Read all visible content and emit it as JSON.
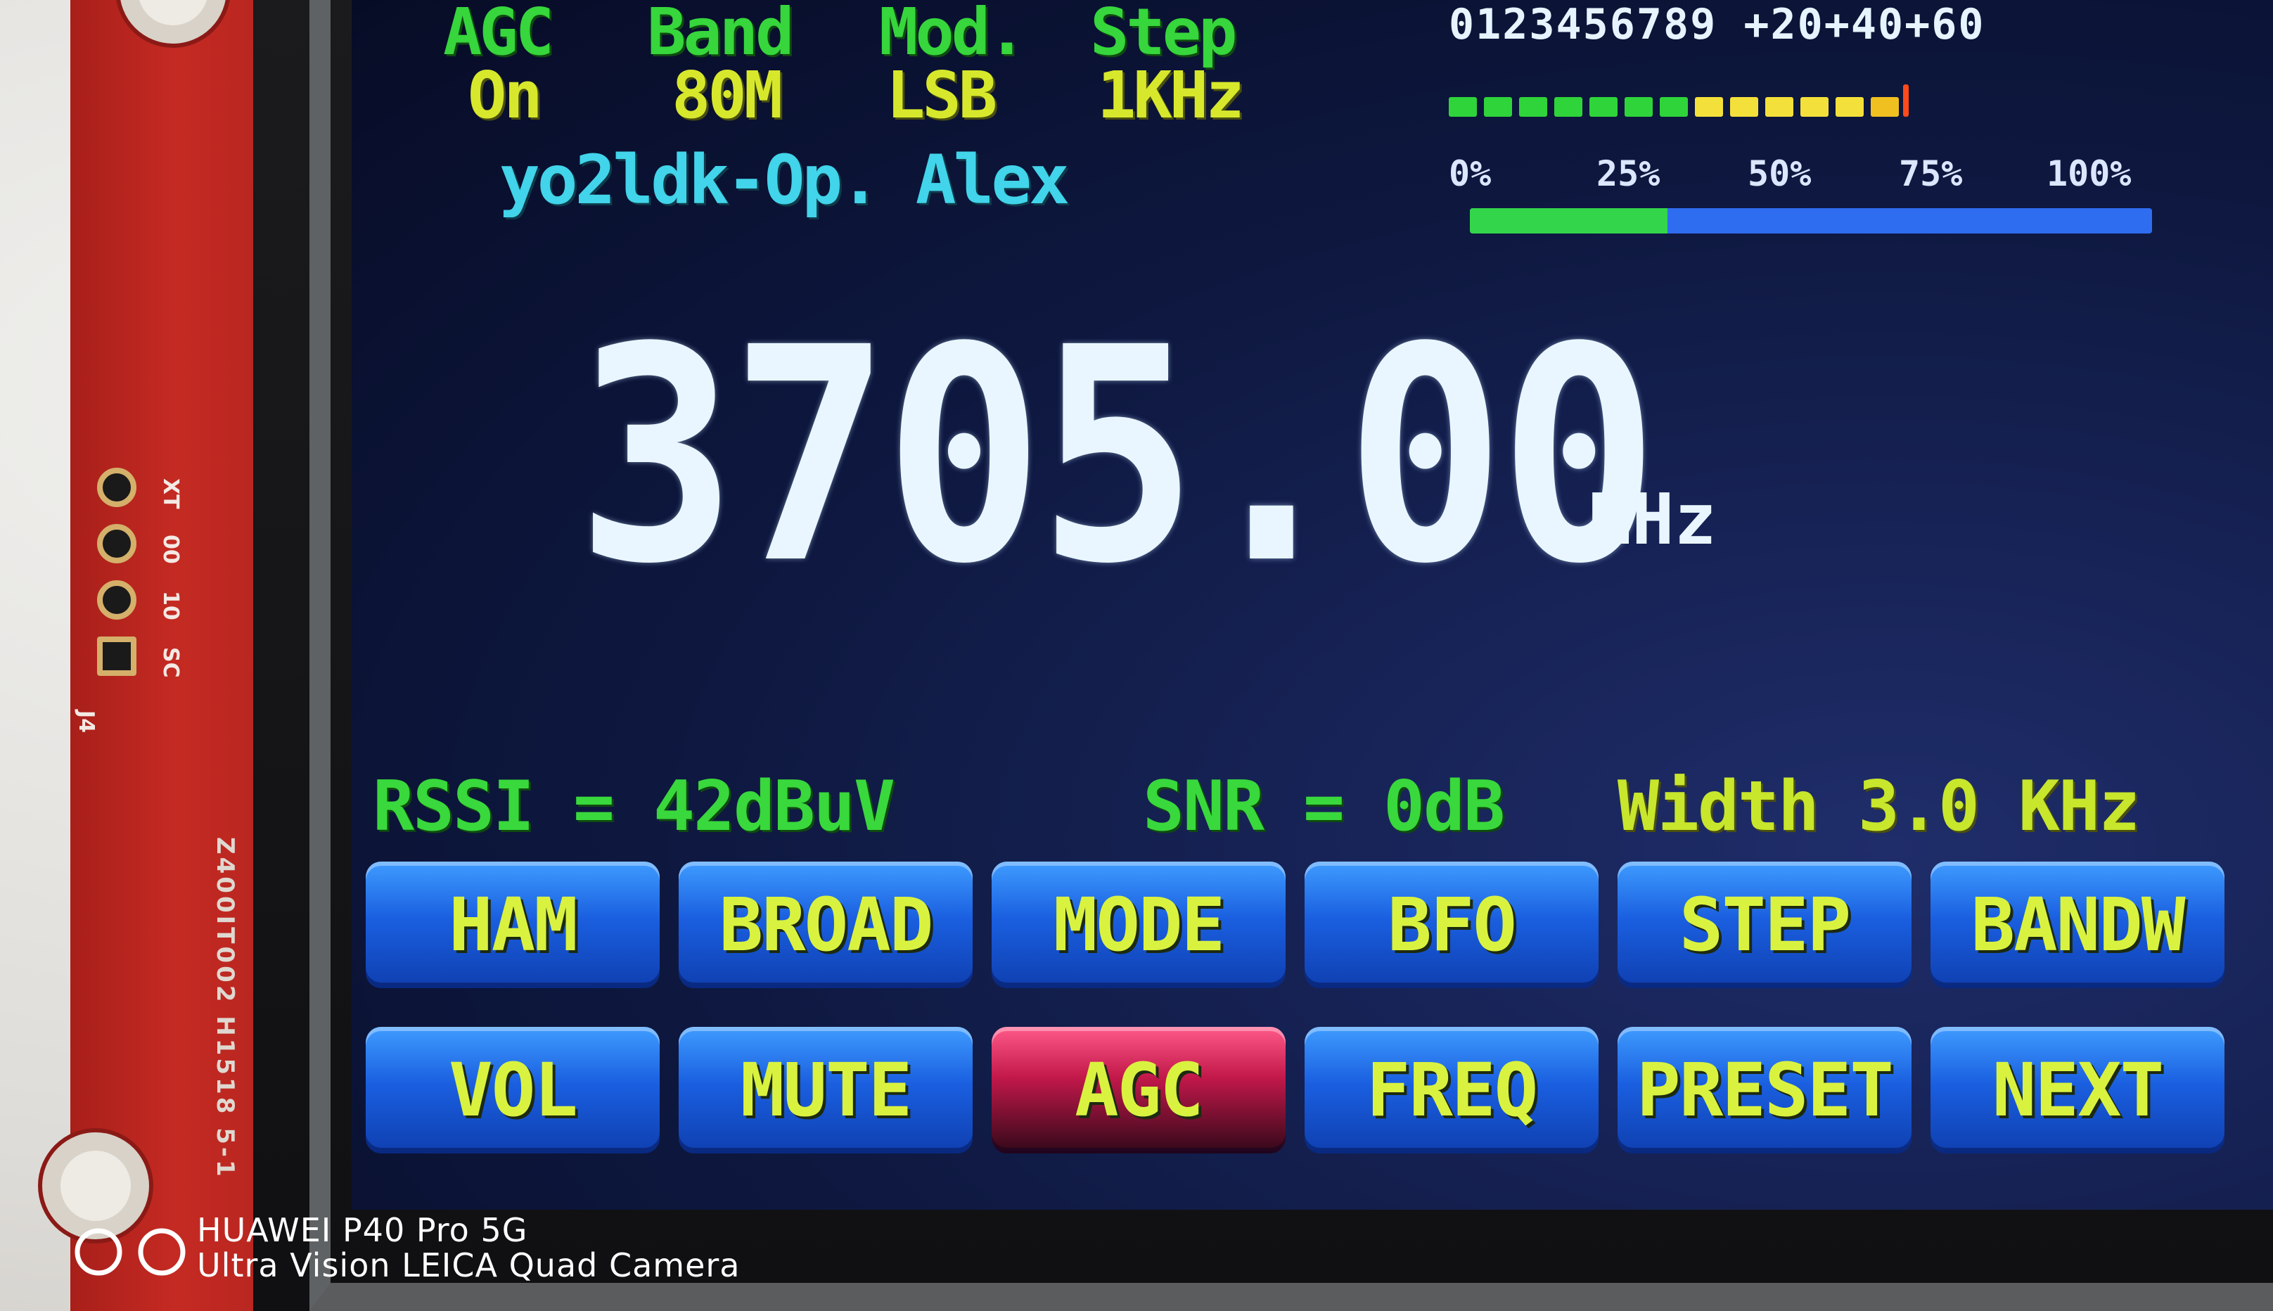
{
  "status": {
    "agc": {
      "label": "AGC",
      "value": "On"
    },
    "band": {
      "label": "Band",
      "value": "80M"
    },
    "mod": {
      "label": "Mod.",
      "value": "LSB"
    },
    "step": {
      "label": "Step",
      "value": "1KHz"
    }
  },
  "callsign": "yo2ldk-Op. Alex",
  "smeter": {
    "scale": "0123456789 +20+40+60",
    "segments_lit": 13
  },
  "tuning": {
    "percent_labels": [
      "0%",
      "25%",
      "50%",
      "75%",
      "100%"
    ],
    "fill_fraction": 0.29
  },
  "frequency": {
    "value": "3705.00",
    "unit": "MHz"
  },
  "signal": {
    "rssi": "RSSI = 42dBuV",
    "snr": "SNR = 0dB",
    "width": "Width 3.0 KHz"
  },
  "buttons": {
    "row1": [
      "HAM",
      "BROAD",
      "MODE",
      "BFO",
      "STEP",
      "BANDW"
    ],
    "row2": [
      "VOL",
      "MUTE",
      "AGC",
      "FREQ",
      "PRESET",
      "NEXT"
    ],
    "active": "AGC"
  },
  "board": {
    "flex_label": "Z400IT002  H1518 5-1",
    "connector": "J4",
    "pin_labels": [
      "XT",
      "00",
      "10",
      "SC"
    ]
  },
  "watermark": {
    "line1": "HUAWEI P40 Pro 5G",
    "line2": "Ultra Vision LEICA Quad Camera"
  },
  "colors": {
    "label_green": "#36d63c",
    "value_yellow": "#d7e82c",
    "callsign_cyan": "#41d4ea",
    "button_blue": "#1a5fe0",
    "button_active": "#c2184a",
    "bar_fill_green": "#33d64a",
    "bar_track_blue": "#2f6df0"
  }
}
